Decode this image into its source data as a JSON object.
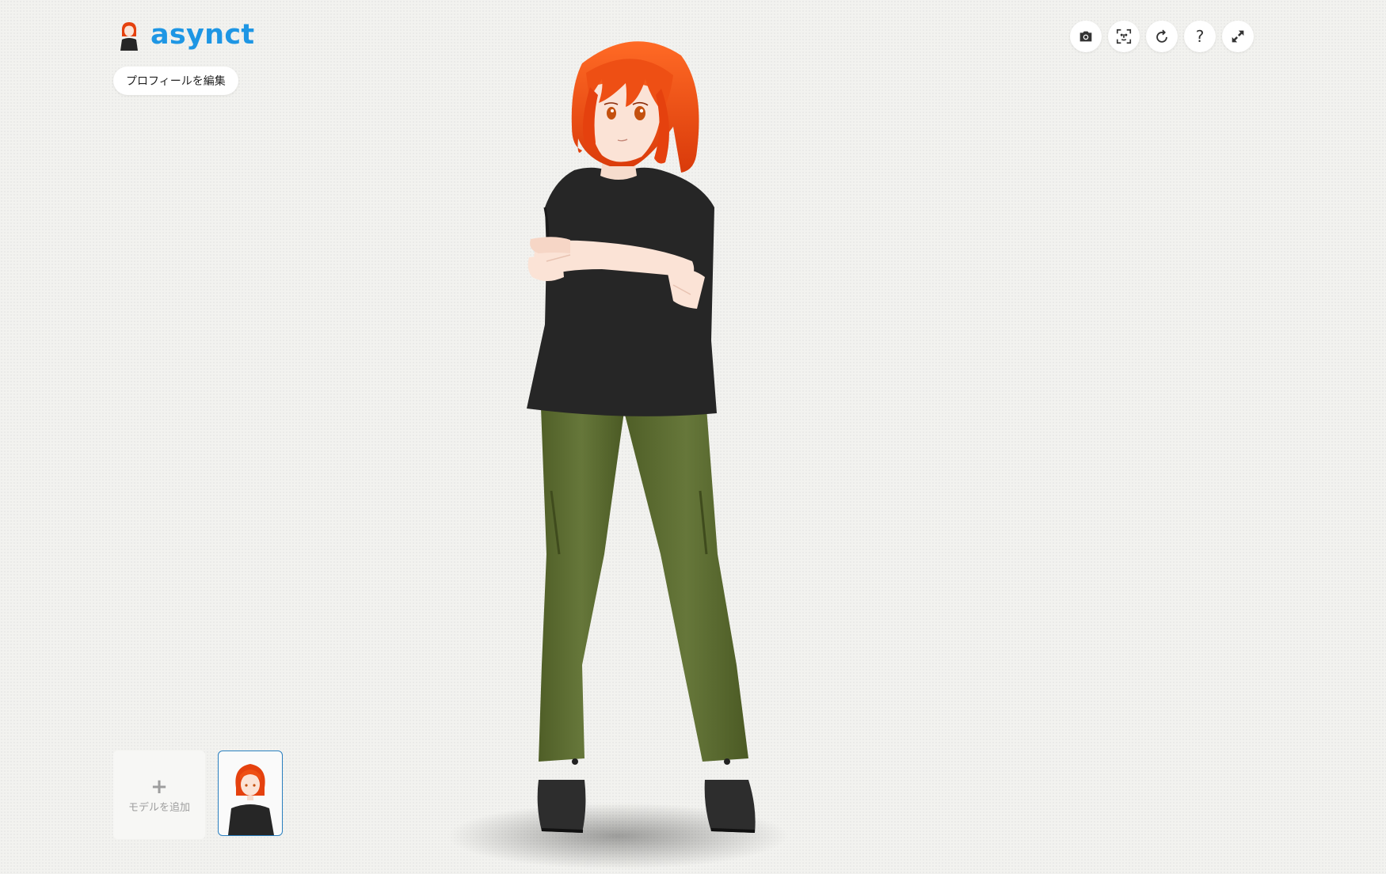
{
  "header": {
    "username": "asynct",
    "edit_profile_label": "プロフィールを編集"
  },
  "toolbar": {
    "icons": [
      "camera-icon",
      "face-scan-icon",
      "reset-rotation-icon",
      "help-icon",
      "fullscreen-icon"
    ],
    "help_glyph": "?"
  },
  "models": {
    "add_plus": "+",
    "add_label": "モデルを追加"
  },
  "colors": {
    "accent": "#1e96e4",
    "hair": "#e5410e",
    "shirt": "#262626",
    "pants": "#5b6b2f",
    "shoes": "#2b2b2b",
    "skin": "#fbe3d6",
    "thumb_border": "#2a7fbf"
  }
}
